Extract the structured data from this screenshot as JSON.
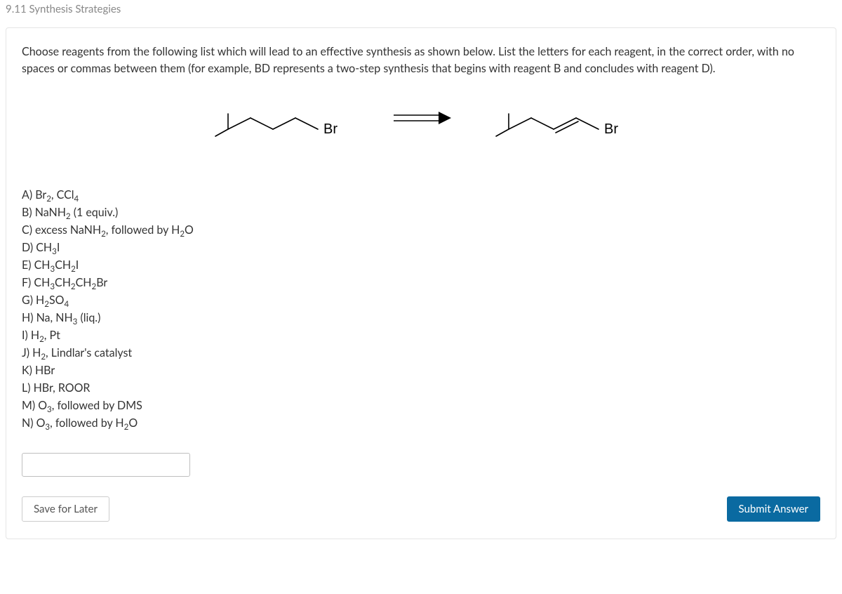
{
  "section_title": "9.11 Synthesis Strategies",
  "prompt": "Choose reagents from the following list which will lead to an effective synthesis as shown below. List the letters for each reagent, in the correct order, with no spaces or commas between them (for example, BD represents a two-step synthesis that begins with reagent B and concludes with reagent D).",
  "diagram": {
    "left_label": "Br",
    "right_label": "Br",
    "left_smiles": "CC(C)CCCBr",
    "right_smiles": "CC(C)C/C=C/Br"
  },
  "reagents": {
    "A": "Br₂, CCl₄",
    "B": "NaNH₂ (1 equiv.)",
    "C": "excess NaNH₂, followed by H₂O",
    "D": "CH₃I",
    "E": "CH₃CH₂I",
    "F": "CH₃CH₂CH₂Br",
    "G": "H₂SO₄",
    "H": "Na, NH₃ (liq.)",
    "I": "H₂, Pt",
    "J": "H₂, Lindlar's catalyst",
    "K": "HBr",
    "L": "HBr, ROOR",
    "M": "O₃, followed by DMS",
    "N": "O₃, followed by H₂O"
  },
  "answer_value": "",
  "buttons": {
    "save": "Save for Later",
    "submit": "Submit Answer"
  }
}
